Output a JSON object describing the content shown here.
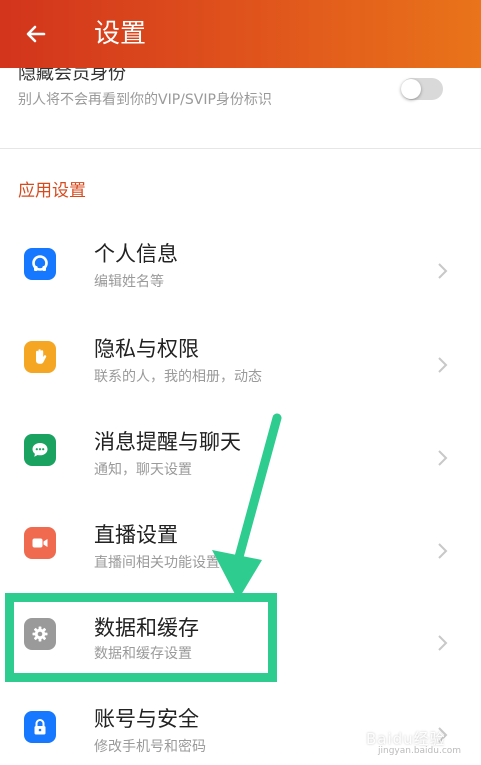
{
  "header": {
    "title": "设置",
    "back_icon": "arrow-left-icon"
  },
  "vip": {
    "title": "隐藏会员身份",
    "subtitle": "别人将不会再看到你的VIP/SVIP身份标识",
    "toggle_on": false
  },
  "section": {
    "title": "应用设置"
  },
  "items": [
    {
      "title": "个人信息",
      "subtitle": "编辑姓名等",
      "icon": "person-icon",
      "color": "#1677ff"
    },
    {
      "title": "隐私与权限",
      "subtitle": "联系的人，我的相册，动态",
      "icon": "hand-icon",
      "color": "#f5a623"
    },
    {
      "title": "消息提醒与聊天",
      "subtitle": "通知，聊天设置",
      "icon": "chat-bubble-icon",
      "color": "#1aa260"
    },
    {
      "title": "直播设置",
      "subtitle": "直播间相关功能设置",
      "icon": "video-camera-icon",
      "color": "#f06a4f"
    },
    {
      "title": "数据和缓存",
      "subtitle": "数据和缓存设置",
      "icon": "gear-icon",
      "color": "#9a9a9a"
    },
    {
      "title": "账号与安全",
      "subtitle": "修改手机号和密码",
      "icon": "lock-icon",
      "color": "#1677ff"
    }
  ],
  "annotation": {
    "highlight_color": "#2ecc8e"
  },
  "watermark": {
    "text": "Baidu经验",
    "subtext": "jingyan.baidu.com"
  }
}
